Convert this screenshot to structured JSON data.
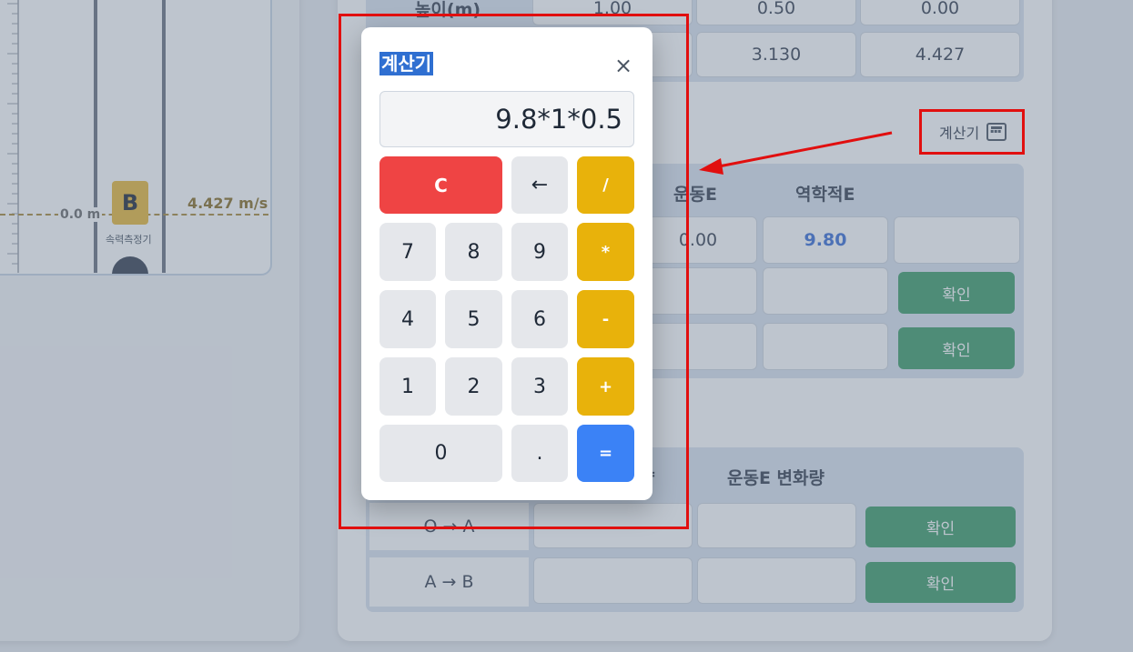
{
  "simulation": {
    "point_label": "B",
    "height_readout": "0.0 m",
    "speed_readout": "4.427 m/s",
    "sensor_label": "속력측정기"
  },
  "table1": {
    "row_label": "높이(m)",
    "row_values": [
      "1.00",
      "0.50",
      "0.00"
    ],
    "speed_values": [
      "3.130",
      "4.427"
    ]
  },
  "calculator_toggle": {
    "label": "계산기",
    "icon": "calculator-icon"
  },
  "table2": {
    "headers": [
      "운동E",
      "역학적E"
    ],
    "row1": [
      "0.00",
      "9.80",
      ""
    ],
    "confirm_label": "확인"
  },
  "table3": {
    "headers": [
      "량",
      "운동E 변화량"
    ],
    "rows": [
      {
        "label": "O → A",
        "confirm": "확인"
      },
      {
        "label": "A → B",
        "confirm": "확인"
      }
    ]
  },
  "calculator": {
    "title": "계산기",
    "close": "×",
    "display": "9.8*1*0.5",
    "keys": {
      "clear": "C",
      "back": "←",
      "div": "/",
      "mul": "*",
      "minus": "-",
      "plus": "+",
      "eq": "=",
      "dot": ".",
      "n0": "0",
      "n1": "1",
      "n2": "2",
      "n3": "3",
      "n4": "4",
      "n5": "5",
      "n6": "6",
      "n7": "7",
      "n8": "8",
      "n9": "9"
    }
  },
  "colors": {
    "accent_red": "#e10f0f",
    "clear_key": "#ef4444",
    "operator_key": "#e8b20b",
    "equals_key": "#3b82f6",
    "confirm_button": "#3f9e6a",
    "mechanical_energy_value": "#3b6fd6"
  }
}
